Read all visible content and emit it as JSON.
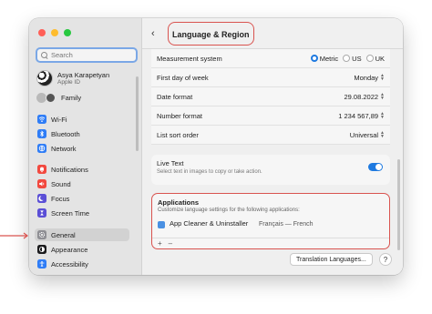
{
  "colors": {
    "accent": "#1f7ae0",
    "highlight": "#d9534f"
  },
  "sidebar": {
    "search_placeholder": "Search",
    "user": {
      "name": "Asya Karapetyan",
      "sub": "Apple ID"
    },
    "family_label": "Family",
    "items": [
      {
        "label": "Wi-Fi",
        "icon": "wifi-icon",
        "color": "#2f7df6"
      },
      {
        "label": "Bluetooth",
        "icon": "bluetooth-icon",
        "color": "#2f7df6"
      },
      {
        "label": "Network",
        "icon": "network-icon",
        "color": "#2f7df6"
      },
      {
        "label": "Notifications",
        "icon": "bell-icon",
        "color": "#f2493f"
      },
      {
        "label": "Sound",
        "icon": "speaker-icon",
        "color": "#f2493f"
      },
      {
        "label": "Focus",
        "icon": "moon-icon",
        "color": "#5b4fd6"
      },
      {
        "label": "Screen Time",
        "icon": "hourglass-icon",
        "color": "#5b4fd6"
      },
      {
        "label": "General",
        "icon": "gear-icon",
        "color": "#8e8e93"
      },
      {
        "label": "Appearance",
        "icon": "appearance-icon",
        "color": "#1c1c1e"
      },
      {
        "label": "Accessibility",
        "icon": "accessibility-icon",
        "color": "#2f7df6"
      }
    ],
    "selected": "General"
  },
  "header": {
    "title": "Language & Region"
  },
  "settings": {
    "measurement": {
      "label": "Measurement system",
      "options": [
        "Metric",
        "US",
        "UK"
      ],
      "selected": "Metric"
    },
    "first_day": {
      "label": "First day of week",
      "value": "Monday"
    },
    "date_format": {
      "label": "Date format",
      "value": "29.08.2022"
    },
    "number_format": {
      "label": "Number format",
      "value": "1 234 567,89"
    },
    "list_sort": {
      "label": "List sort order",
      "value": "Universal"
    }
  },
  "live_text": {
    "title": "Live Text",
    "subtitle": "Select text in images to copy or take action.",
    "enabled": true
  },
  "applications": {
    "title": "Applications",
    "subtitle": "Customize language settings for the following applications:",
    "items": [
      {
        "name": "App Cleaner & Uninstaller",
        "language": "Français — French"
      }
    ],
    "add_label": "+",
    "remove_label": "–"
  },
  "footer": {
    "translation_button": "Translation Languages...",
    "help_label": "?"
  }
}
